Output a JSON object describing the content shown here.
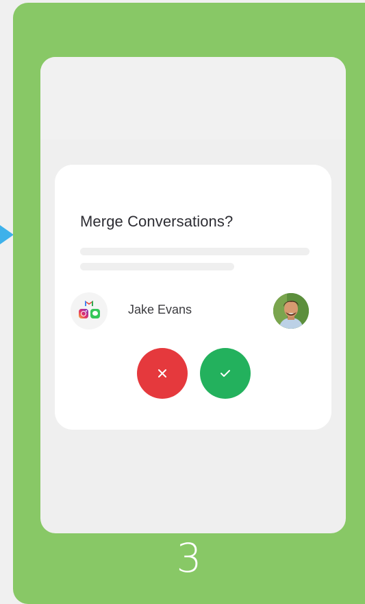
{
  "dialog": {
    "title": "Merge Conversations?",
    "contact_name": "Jake Evans",
    "reject_icon": "close-icon",
    "accept_icon": "check-icon",
    "channels": [
      "gmail-icon",
      "instagram-icon",
      "imessage-icon"
    ]
  },
  "step": {
    "number": "3"
  },
  "colors": {
    "panel_green": "#88c866",
    "reject_red": "#e5393d",
    "accept_green": "#23b15d",
    "pointer_blue": "#3eb1ea"
  }
}
